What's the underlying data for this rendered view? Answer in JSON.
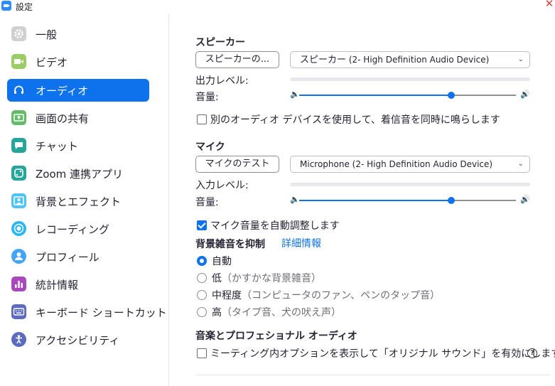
{
  "window": {
    "title": "設定"
  },
  "sidebar": {
    "items": [
      {
        "label": "一般",
        "icon": "gear-icon",
        "color": "#d0d0d4"
      },
      {
        "label": "ビデオ",
        "icon": "video-icon",
        "color": "#9ccc65"
      },
      {
        "label": "オーディオ",
        "icon": "headphones-icon",
        "color": "#0e72ed",
        "active": true
      },
      {
        "label": "画面の共有",
        "icon": "share-screen-icon",
        "color": "#66bb6a"
      },
      {
        "label": "チャット",
        "icon": "chat-icon",
        "color": "#26a69a"
      },
      {
        "label": "Zoom 連携アプリ",
        "icon": "apps-icon",
        "color": "#26a69a"
      },
      {
        "label": "背景とエフェクト",
        "icon": "background-icon",
        "color": "#4fc3f7"
      },
      {
        "label": "レコーディング",
        "icon": "record-icon",
        "color": "#29b6f6"
      },
      {
        "label": "プロフィール",
        "icon": "profile-icon",
        "color": "#42a5f5"
      },
      {
        "label": "統計情報",
        "icon": "stats-icon",
        "color": "#ab47bc"
      },
      {
        "label": "キーボード ショートカット",
        "icon": "keyboard-icon",
        "color": "#5c6bc0"
      },
      {
        "label": "アクセシビリティ",
        "icon": "accessibility-icon",
        "color": "#5c6bc0"
      }
    ]
  },
  "speaker": {
    "title": "スピーカー",
    "test_button": "スピーカーの...",
    "device_prefix": "スピーカー",
    "device_name": "(2- High Definition Audio Device)",
    "output_level_label": "出力レベル:",
    "volume_label": "音量:",
    "volume_value": 0.7
  },
  "ring_option": {
    "label": "別のオーディオ デバイスを使用して、着信音を同時に鳴らします",
    "checked": false
  },
  "mic": {
    "title": "マイク",
    "test_button": "マイクのテスト",
    "device": "Microphone (2- High Definition Audio Device)",
    "input_level_label": "入力レベル:",
    "volume_label": "音量:",
    "volume_value": 0.7
  },
  "auto_adjust": {
    "label": "マイク音量を自動調整します",
    "checked": true
  },
  "noise": {
    "title": "背景雑音を抑制",
    "link": "詳細情報",
    "options": [
      {
        "label": "自動",
        "hint": "",
        "selected": true
      },
      {
        "label": "低",
        "hint": "（かすかな背景雑音）",
        "selected": false
      },
      {
        "label": "中程度",
        "hint": "（コンピュータのファン、ペンのタップ音）",
        "selected": false
      },
      {
        "label": "高",
        "hint": "（タイプ音、犬の吠え声）",
        "selected": false
      }
    ]
  },
  "music": {
    "title": "音楽とプロフェショナル オーディオ",
    "option_label": "ミーティング内オプションを表示して「オリジナル サウンド」を有効にします",
    "checked": false
  }
}
